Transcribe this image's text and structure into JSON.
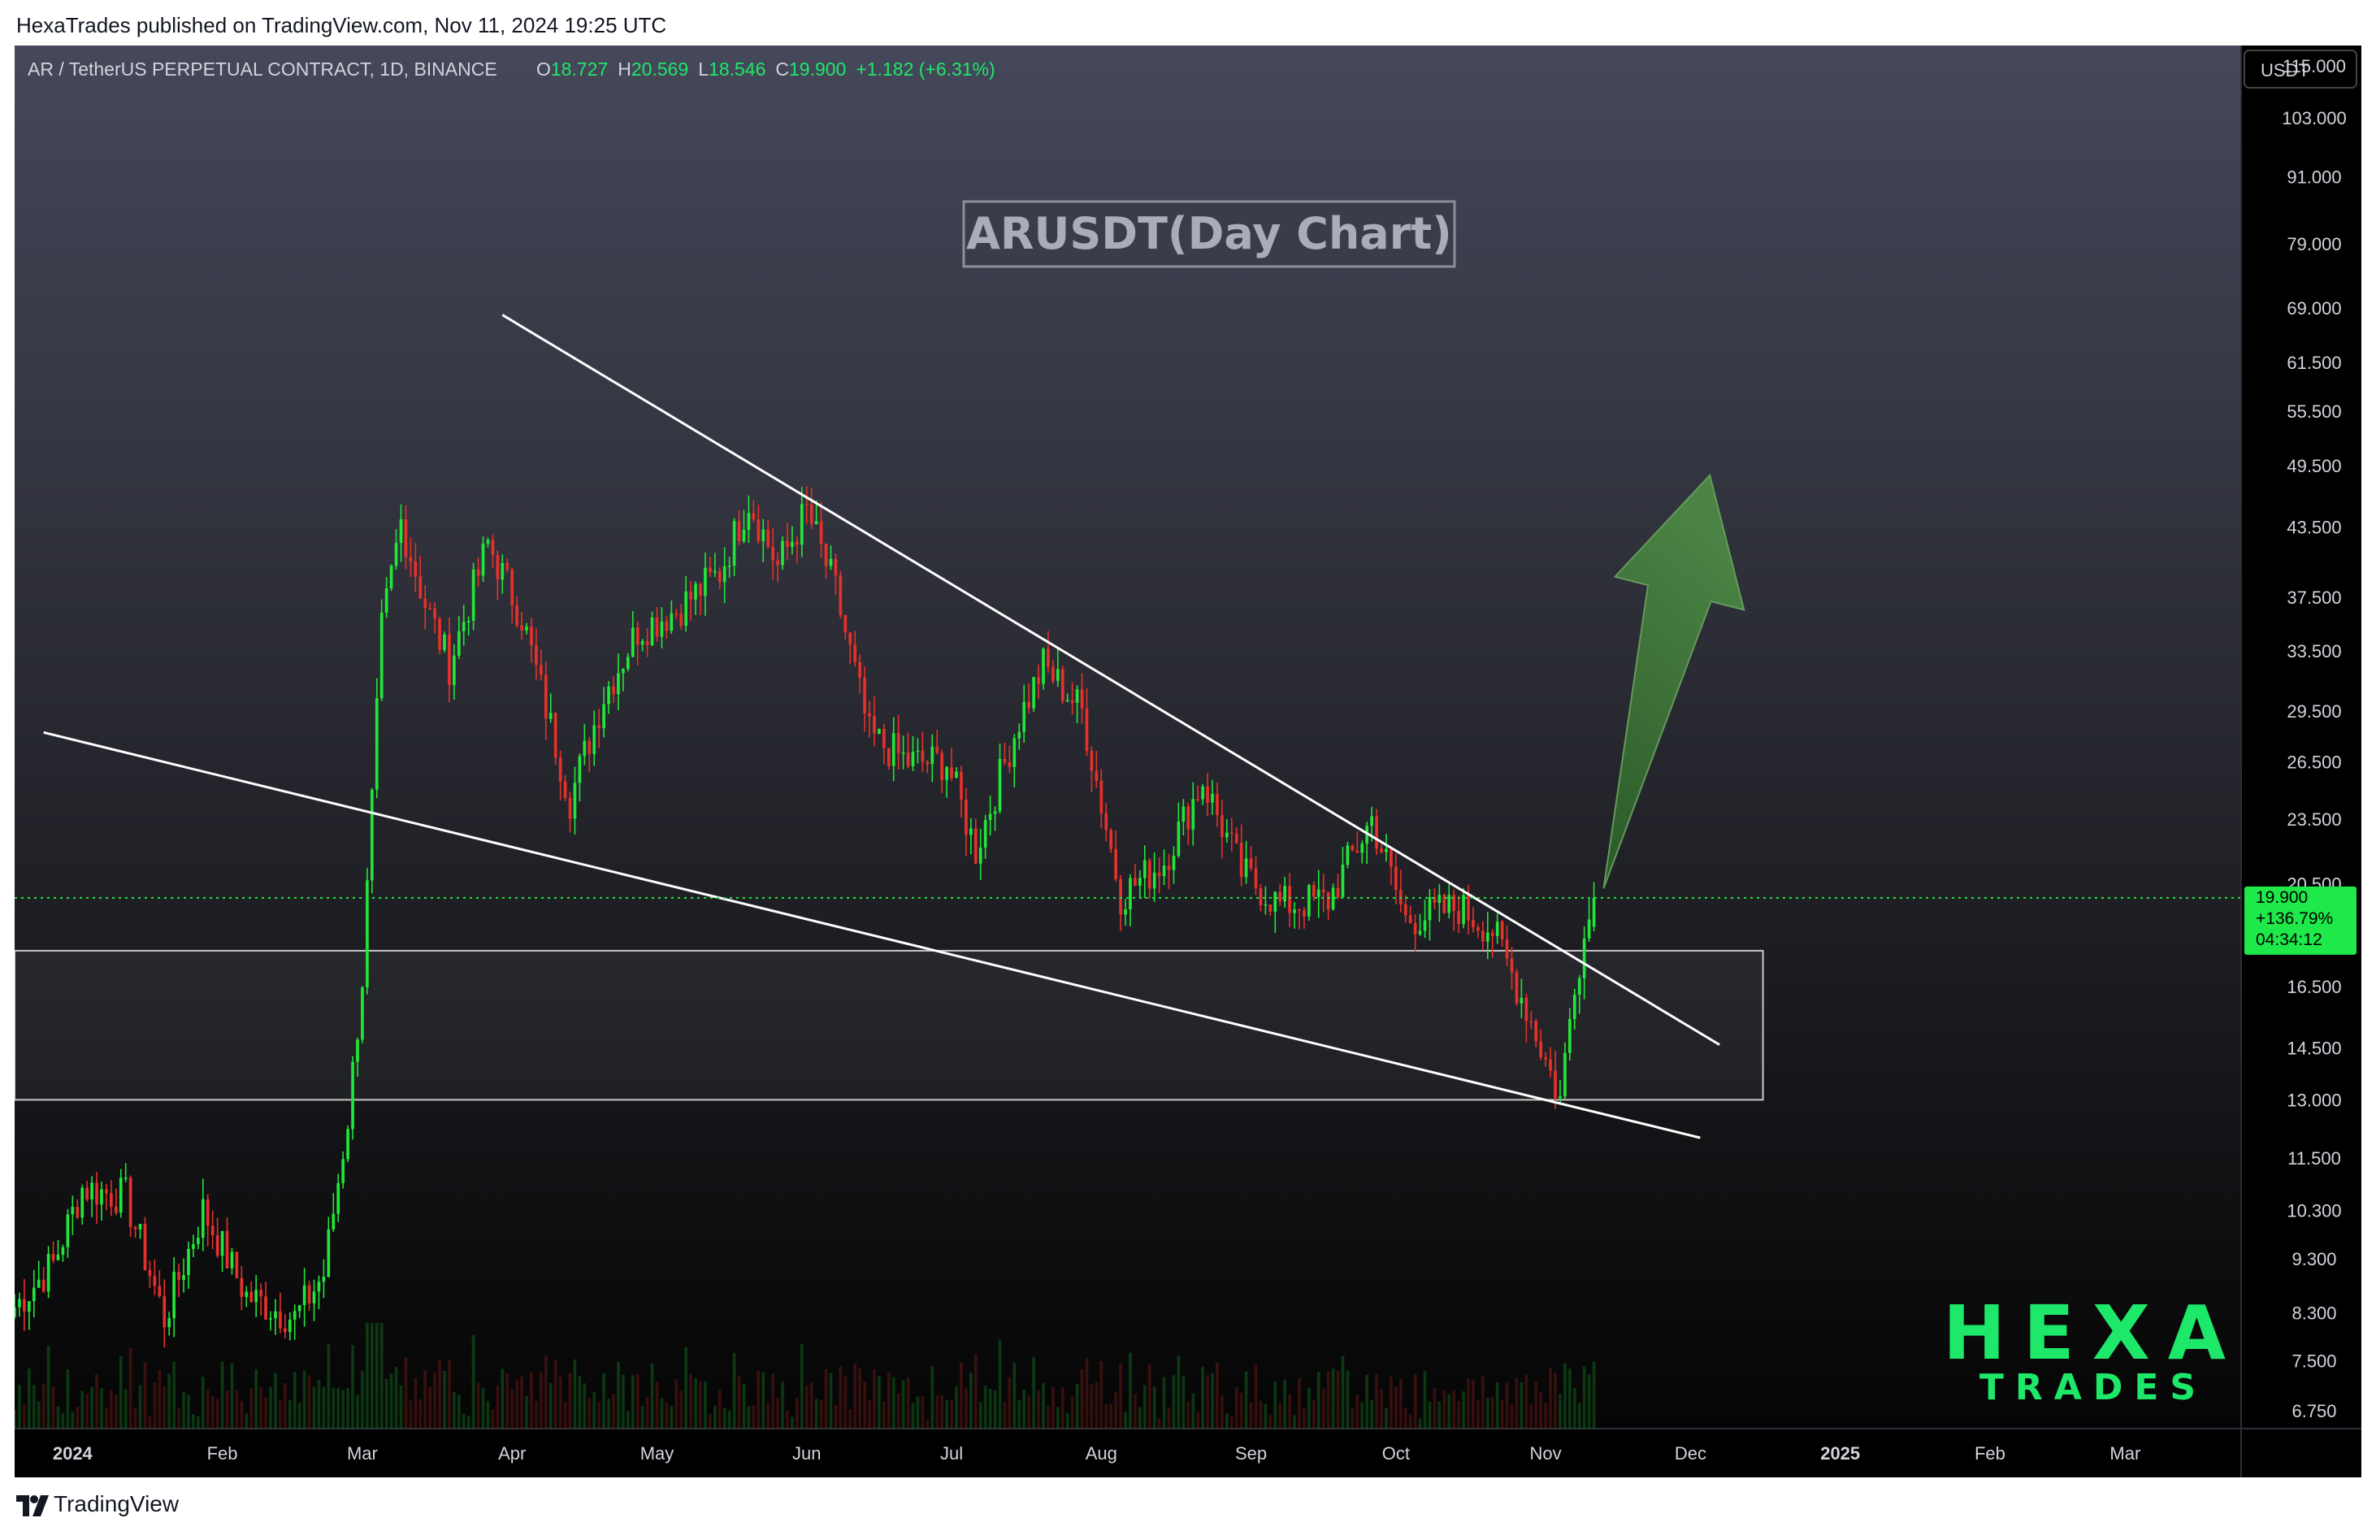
{
  "header": {
    "publisher_line": "HexaTrades published on TradingView.com, Nov 11, 2024 19:25 UTC"
  },
  "symbol_bar": {
    "symbol": "AR / TetherUS PERPETUAL CONTRACT, 1D, BINANCE",
    "ohlc": [
      {
        "key": "O",
        "value": "18.727"
      },
      {
        "key": "H",
        "value": "20.569"
      },
      {
        "key": "L",
        "value": "18.546"
      },
      {
        "key": "C",
        "value": "19.900"
      }
    ],
    "change": "+1.182 (+6.31%)"
  },
  "price_scale": {
    "currency": "USDT",
    "ticks": [
      "115.000",
      "103.000",
      "91.000",
      "79.000",
      "69.000",
      "61.500",
      "55.500",
      "49.500",
      "43.500",
      "37.500",
      "33.500",
      "29.500",
      "26.500",
      "23.500",
      "20.500",
      "16.500",
      "14.500",
      "13.000",
      "11.500",
      "10.300",
      "9.300",
      "8.300",
      "7.500",
      "6.750"
    ],
    "last_price": "19.900",
    "last_change": "+136.79%",
    "countdown": "04:34:12"
  },
  "time_axis": {
    "labels": [
      {
        "label": "2024",
        "bold": true,
        "date": "2024-01-01"
      },
      {
        "label": "Feb",
        "bold": false,
        "date": "2024-02-01"
      },
      {
        "label": "Mar",
        "bold": false,
        "date": "2024-03-01"
      },
      {
        "label": "Apr",
        "bold": false,
        "date": "2024-04-01"
      },
      {
        "label": "May",
        "bold": false,
        "date": "2024-05-01"
      },
      {
        "label": "Jun",
        "bold": false,
        "date": "2024-06-01"
      },
      {
        "label": "Jul",
        "bold": false,
        "date": "2024-07-01"
      },
      {
        "label": "Aug",
        "bold": false,
        "date": "2024-08-01"
      },
      {
        "label": "Sep",
        "bold": false,
        "date": "2024-09-01"
      },
      {
        "label": "Oct",
        "bold": false,
        "date": "2024-10-01"
      },
      {
        "label": "Nov",
        "bold": false,
        "date": "2024-11-01"
      },
      {
        "label": "Dec",
        "bold": false,
        "date": "2024-12-01"
      },
      {
        "label": "2025",
        "bold": true,
        "date": "2025-01-01"
      },
      {
        "label": "Feb",
        "bold": false,
        "date": "2025-02-01"
      },
      {
        "label": "Mar",
        "bold": false,
        "date": "2025-03-01"
      }
    ]
  },
  "annotations": {
    "chart_title": "ARUSDT(Day Chart)",
    "watermark_top": "HEXA",
    "watermark_bottom": "TRADES"
  },
  "footer": {
    "brand": "TradingView"
  },
  "colors": {
    "up": "#22e53a",
    "down": "#e5312b",
    "accent_green": "#1ee86a",
    "arrow_fill": "#3e7a3a",
    "lines": "#ffffff"
  },
  "chart_data": {
    "type": "candlestick",
    "scale": "log",
    "ylim": [
      6.5,
      120
    ],
    "xlim": [
      "2023-12-20",
      "2025-03-25"
    ],
    "anchors": [
      {
        "date": "2023-12-20",
        "price": 8.4
      },
      {
        "date": "2023-12-28",
        "price": 9.2
      },
      {
        "date": "2024-01-03",
        "price": 10.8
      },
      {
        "date": "2024-01-12",
        "price": 10.6
      },
      {
        "date": "2024-01-20",
        "price": 8.2
      },
      {
        "date": "2024-01-28",
        "price": 10.3
      },
      {
        "date": "2024-02-06",
        "price": 8.6
      },
      {
        "date": "2024-02-16",
        "price": 8.2
      },
      {
        "date": "2024-02-22",
        "price": 9.0
      },
      {
        "date": "2024-02-27",
        "price": 12.5
      },
      {
        "date": "2024-03-01",
        "price": 16.8
      },
      {
        "date": "2024-03-05",
        "price": 35.0
      },
      {
        "date": "2024-03-09",
        "price": 44.0
      },
      {
        "date": "2024-03-14",
        "price": 37.0
      },
      {
        "date": "2024-03-19",
        "price": 32.5
      },
      {
        "date": "2024-03-27",
        "price": 42.0
      },
      {
        "date": "2024-04-03",
        "price": 36.0
      },
      {
        "date": "2024-04-13",
        "price": 24.5
      },
      {
        "date": "2024-04-20",
        "price": 30.5
      },
      {
        "date": "2024-04-27",
        "price": 35.0
      },
      {
        "date": "2024-05-05",
        "price": 36.5
      },
      {
        "date": "2024-05-14",
        "price": 39.5
      },
      {
        "date": "2024-05-20",
        "price": 46.0
      },
      {
        "date": "2024-05-26",
        "price": 40.0
      },
      {
        "date": "2024-06-01",
        "price": 45.0
      },
      {
        "date": "2024-06-07",
        "price": 38.0
      },
      {
        "date": "2024-06-14",
        "price": 28.0
      },
      {
        "date": "2024-06-22",
        "price": 26.5
      },
      {
        "date": "2024-06-30",
        "price": 26.5
      },
      {
        "date": "2024-07-06",
        "price": 22.0
      },
      {
        "date": "2024-07-15",
        "price": 29.0
      },
      {
        "date": "2024-07-20",
        "price": 32.5
      },
      {
        "date": "2024-07-28",
        "price": 29.5
      },
      {
        "date": "2024-08-05",
        "price": 20.0
      },
      {
        "date": "2024-08-14",
        "price": 21.5
      },
      {
        "date": "2024-08-22",
        "price": 25.5
      },
      {
        "date": "2024-08-30",
        "price": 21.0
      },
      {
        "date": "2024-09-07",
        "price": 19.6
      },
      {
        "date": "2024-09-17",
        "price": 19.8
      },
      {
        "date": "2024-09-26",
        "price": 23.5
      },
      {
        "date": "2024-10-03",
        "price": 19.0
      },
      {
        "date": "2024-10-14",
        "price": 19.5
      },
      {
        "date": "2024-10-21",
        "price": 18.6
      },
      {
        "date": "2024-10-28",
        "price": 15.8
      },
      {
        "date": "2024-11-04",
        "price": 13.0
      },
      {
        "date": "2024-11-07",
        "price": 16.8
      },
      {
        "date": "2024-11-11",
        "price": 19.9
      }
    ],
    "last": {
      "open": 18.727,
      "high": 20.569,
      "low": 18.546,
      "close": 19.9
    },
    "price_line": 19.9,
    "trendlines": [
      {
        "name": "resistance",
        "from": {
          "date": "2024-03-30",
          "price": 68.0
        },
        "to": {
          "date": "2024-12-07",
          "price": 14.6
        }
      },
      {
        "name": "support",
        "from": {
          "date": "2023-12-26",
          "price": 28.2
        },
        "to": {
          "date": "2024-12-03",
          "price": 12.0
        }
      }
    ],
    "zone": {
      "from": "2023-12-20",
      "to": "2024-12-16",
      "top": 17.8,
      "bottom": 13.0
    },
    "arrow": {
      "from": {
        "date": "2024-11-13",
        "price": 20.3
      },
      "to": {
        "date": "2024-12-05",
        "price": 48.5
      }
    }
  }
}
